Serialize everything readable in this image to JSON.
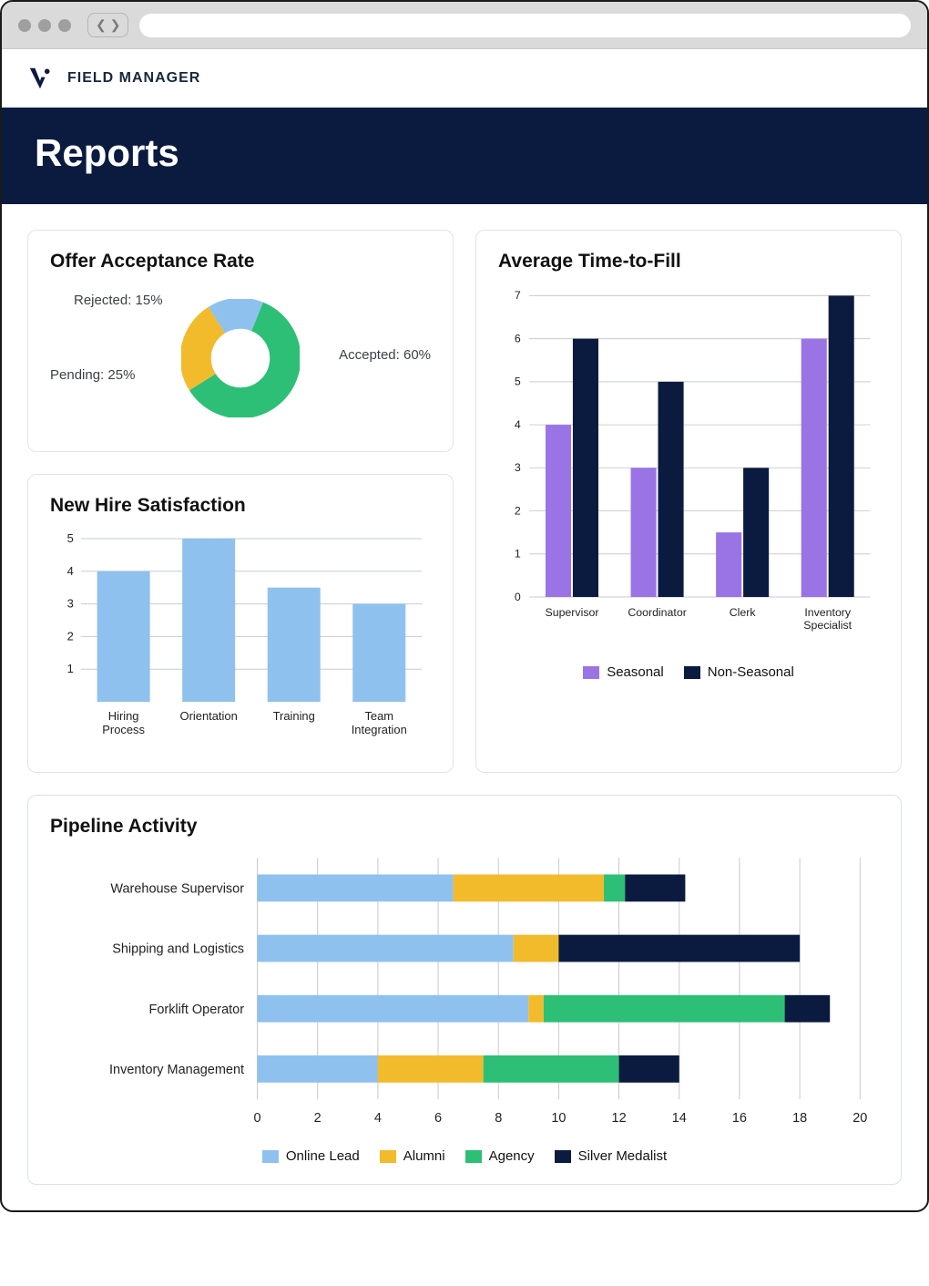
{
  "brand": "FIELD MANAGER",
  "page_title": "Reports",
  "cards": {
    "offer": {
      "title": "Offer Acceptance Rate"
    },
    "satisfaction": {
      "title": "New Hire Satisfaction"
    },
    "ttf": {
      "title": "Average Time-to-Fill"
    },
    "pipeline": {
      "title": "Pipeline Activity"
    }
  },
  "colors": {
    "blue_light": "#8fc1ef",
    "yellow": "#f2bb2b",
    "green": "#2dbf75",
    "navy": "#0a1b3f",
    "purple": "#9a74e5"
  },
  "donut_labels": {
    "accepted": "Accepted: 60%",
    "pending": "Pending: 25%",
    "rejected": "Rejected: 15%"
  },
  "ttf_legend": {
    "seasonal": "Seasonal",
    "nonseasonal": "Non-Seasonal"
  },
  "pipeline_legend": {
    "online": "Online Lead",
    "alumni": "Alumni",
    "agency": "Agency",
    "silver": "Silver Medalist"
  },
  "satisfaction_categories": [
    "Hiring Process",
    "Orientation",
    "Training",
    "Team Integration"
  ],
  "ttf_categories": [
    "Supervisor",
    "Coordinator",
    "Clerk",
    "Inventory Specialist"
  ],
  "pipeline_categories": [
    "Warehouse Supervisor",
    "Shipping and Logistics",
    "Forklift Operator",
    "Inventory Management"
  ],
  "chart_data": [
    {
      "id": "offer_acceptance_rate",
      "type": "pie",
      "title": "Offer Acceptance Rate",
      "series": [
        {
          "name": "Accepted",
          "value": 60,
          "color": "#2dbf75"
        },
        {
          "name": "Pending",
          "value": 25,
          "color": "#f2bb2b"
        },
        {
          "name": "Rejected",
          "value": 15,
          "color": "#8fc1ef"
        }
      ]
    },
    {
      "id": "new_hire_satisfaction",
      "type": "bar",
      "title": "New Hire Satisfaction",
      "categories": [
        "Hiring Process",
        "Orientation",
        "Training",
        "Team Integration"
      ],
      "values": [
        4,
        5,
        3.5,
        3
      ],
      "ylim": [
        0,
        5
      ],
      "yticks": [
        1,
        2,
        3,
        4,
        5
      ],
      "color": "#8fc1ef"
    },
    {
      "id": "average_time_to_fill",
      "type": "bar",
      "title": "Average Time-to-Fill",
      "categories": [
        "Supervisor",
        "Coordinator",
        "Clerk",
        "Inventory Specialist"
      ],
      "series": [
        {
          "name": "Seasonal",
          "color": "#9a74e5",
          "values": [
            4,
            3,
            1.5,
            6
          ]
        },
        {
          "name": "Non-Seasonal",
          "color": "#0a1b3f",
          "values": [
            6,
            5,
            3,
            7
          ]
        }
      ],
      "ylim": [
        0,
        7
      ],
      "yticks": [
        0,
        1,
        2,
        3,
        4,
        5,
        6,
        7
      ]
    },
    {
      "id": "pipeline_activity",
      "type": "bar",
      "orientation": "horizontal",
      "stacked": true,
      "title": "Pipeline Activity",
      "categories": [
        "Warehouse Supervisor",
        "Shipping and Logistics",
        "Forklift Operator",
        "Inventory Management"
      ],
      "series": [
        {
          "name": "Online Lead",
          "color": "#8fc1ef",
          "values": [
            6.5,
            8.5,
            9,
            4
          ]
        },
        {
          "name": "Alumni",
          "color": "#f2bb2b",
          "values": [
            5,
            1.5,
            0.5,
            3.5
          ]
        },
        {
          "name": "Agency",
          "color": "#2dbf75",
          "values": [
            0.7,
            0,
            8,
            4.5
          ]
        },
        {
          "name": "Silver Medalist",
          "color": "#0a1b3f",
          "values": [
            2,
            8,
            1.5,
            2
          ]
        }
      ],
      "xlim": [
        0,
        20
      ],
      "xticks": [
        0,
        2,
        4,
        6,
        8,
        10,
        12,
        14,
        16,
        18,
        20
      ]
    }
  ]
}
